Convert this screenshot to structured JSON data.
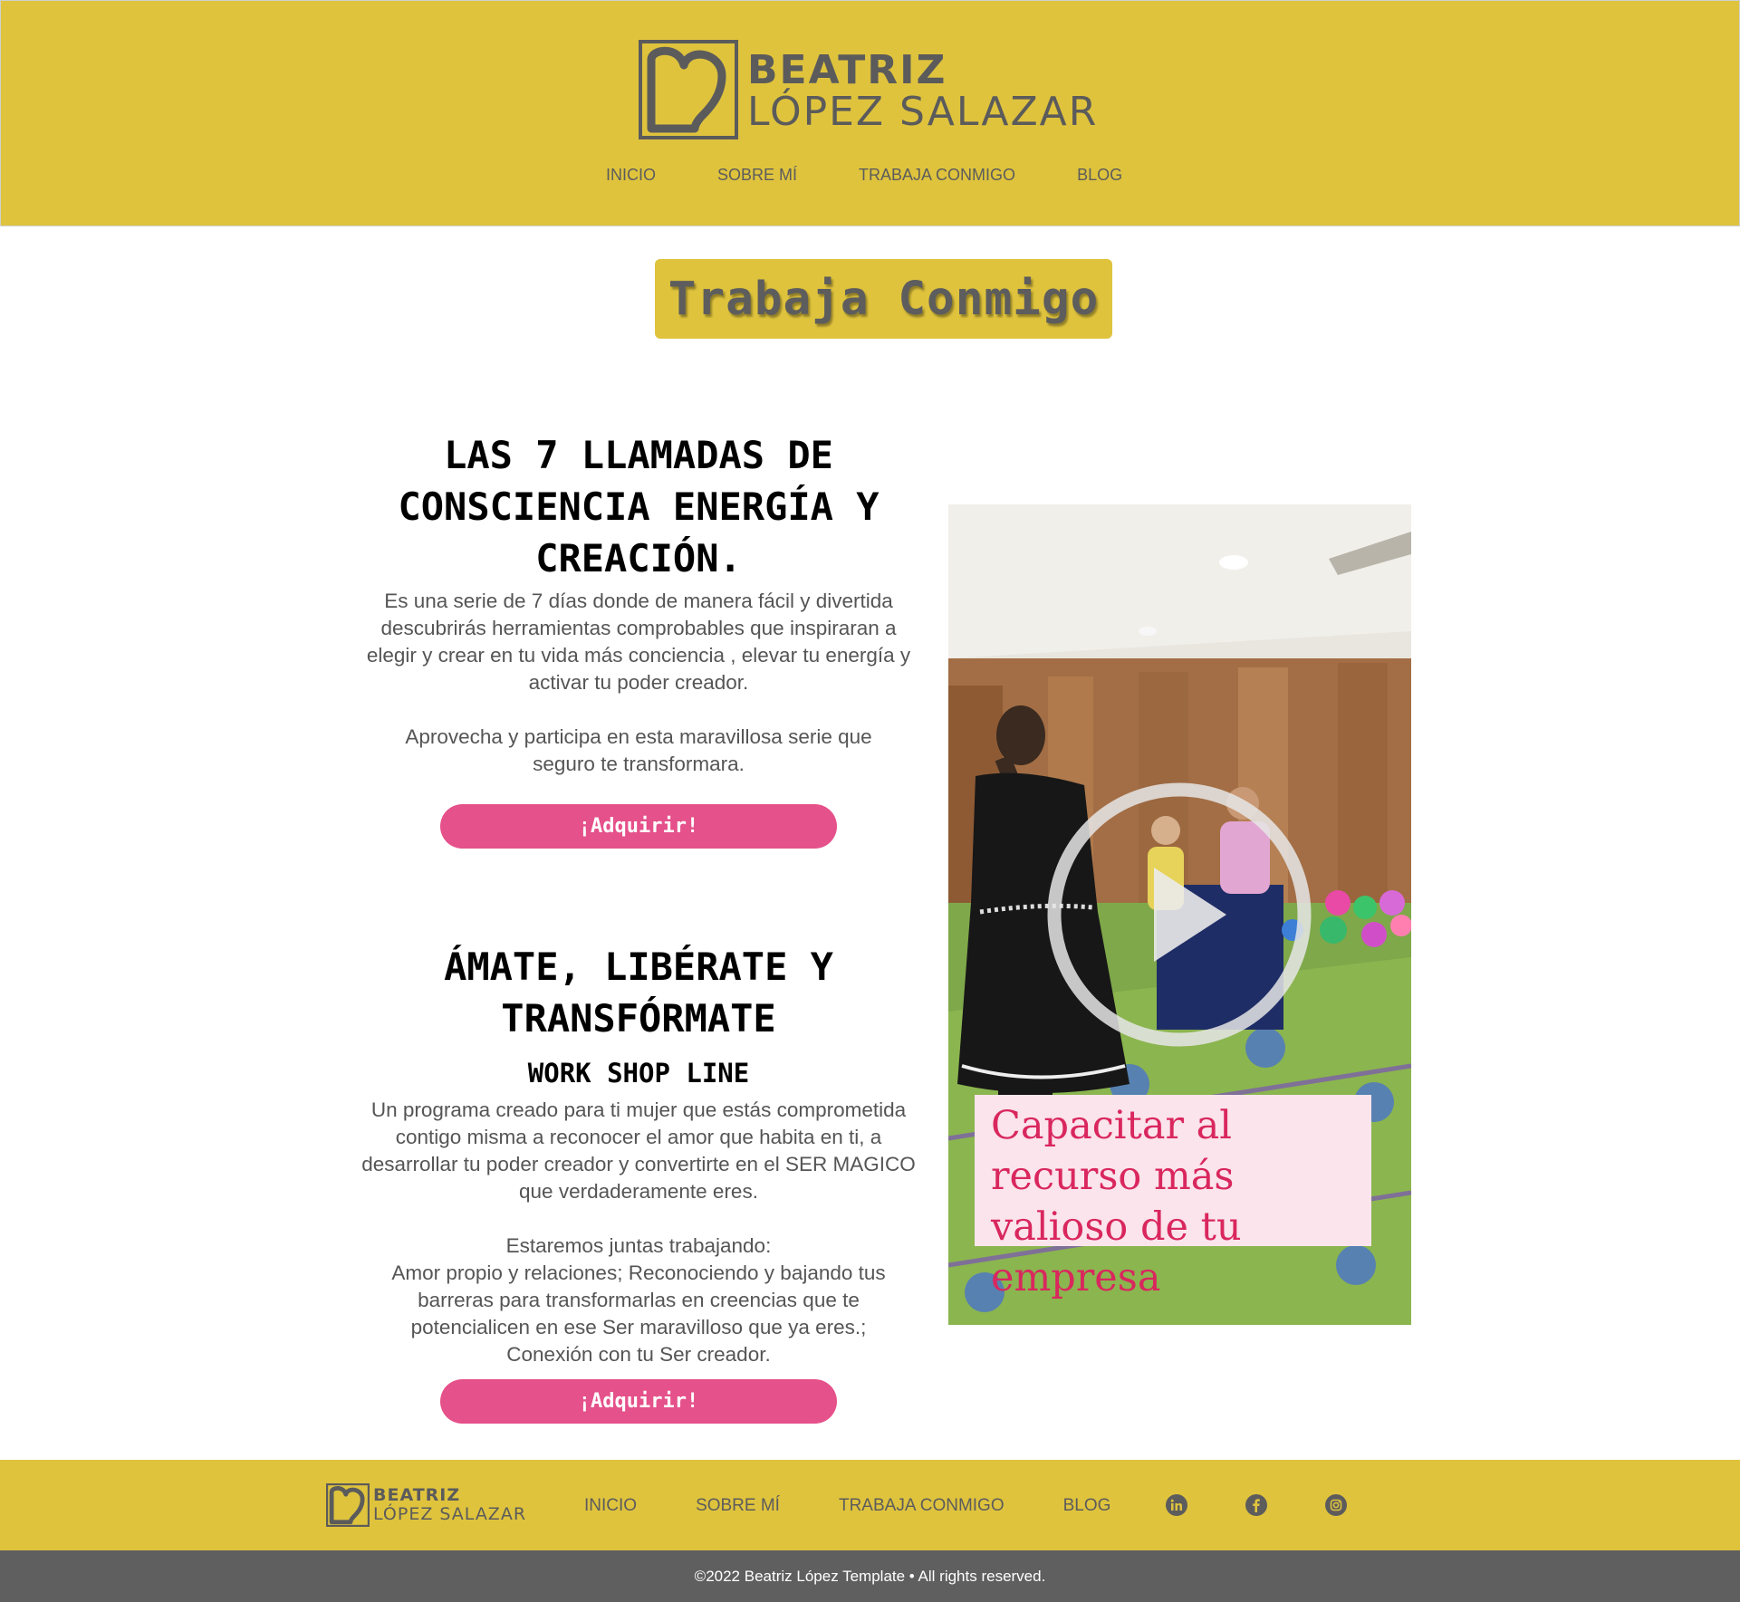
{
  "brand": {
    "line1": "BEATRIZ",
    "line2": "LÓPEZ SALAZAR",
    "colors": {
      "yellow": "#DFC33D",
      "pink": "#E5518A",
      "gray": "#5F5F5F",
      "logo_gray": "#5b5b5b"
    }
  },
  "nav": {
    "items": [
      "INICIO",
      "SOBRE MÍ",
      "TRABAJA CONMIGO",
      "BLOG"
    ]
  },
  "page": {
    "title": "Trabaja Conmigo"
  },
  "offer1": {
    "title": "LAS 7 LLAMADAS DE CONSCIENCIA ENERGÍA Y CREACIÓN.",
    "description": "Es una serie de 7 días  donde de manera fácil y divertida descubrirás herramientas comprobables que inspiraran a elegir y crear en tu vida más conciencia , elevar tu energía y activar tu poder creador.",
    "note": "Aprovecha y participa en esta maravillosa serie que seguro te transformara.",
    "button_label": "¡Adquirir!"
  },
  "offer2": {
    "title": "ÁMATE, LIBÉRATE Y TRANSFÓRMATE",
    "subtitle": "WORK SHOP LINE",
    "description": "Un programa creado para ti mujer que estás comprometida contigo misma a reconocer el amor que habita en ti, a desarrollar tu poder creador y convertirte en el SER MAGICO que verdaderamente eres.",
    "details": "Estaremos juntas trabajando:\nAmor propio y relaciones; Reconociendo y bajando tus barreras para transformarlas en creencias que te potencialicen en ese Ser maravilloso que ya eres.; Conexión con tu Ser creador.",
    "button_label": "¡Adquirir!"
  },
  "video": {
    "caption": "Capacitar al recurso más valioso de tu empresa",
    "play_icon": "play-icon"
  },
  "footer": {
    "social_icons": [
      "linkedin-icon",
      "facebook-icon",
      "instagram-icon"
    ],
    "copyright": "©2022 Beatriz López Template • All rights reserved."
  }
}
